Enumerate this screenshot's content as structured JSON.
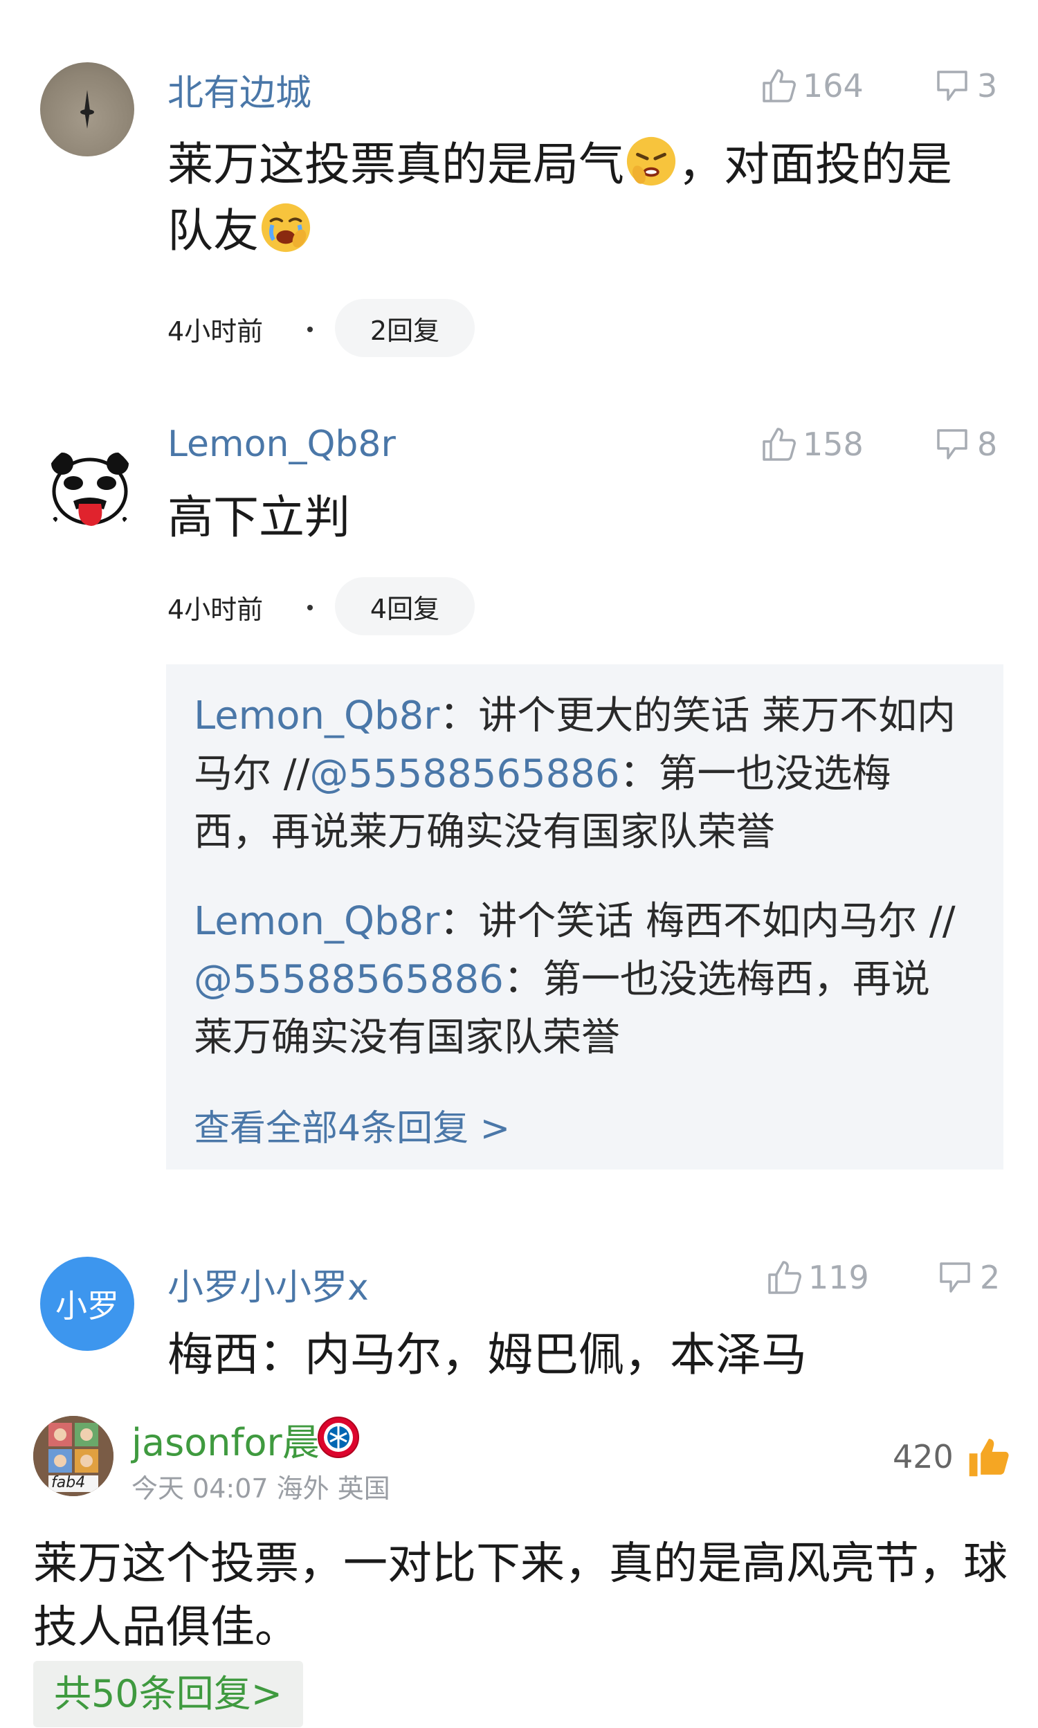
{
  "comments": [
    {
      "username": "北有边城",
      "likes": "164",
      "dislikes": "3",
      "text_line1_a": "莱万这投票真的是局气",
      "text_line1_b": "，对面投的是",
      "text_line2": "队友",
      "emoji1": "angry-face-icon",
      "emoji2": "crying-face-icon",
      "time": "4小时前",
      "replies": "2回复"
    },
    {
      "username": "Lemon_Qb8r",
      "likes": "158",
      "dislikes": "8",
      "text": "高下立判",
      "time": "4小时前",
      "replies": "4回复",
      "sub_replies": [
        {
          "author": "Lemon_Qb8r",
          "sep": "：",
          "line1": "讲个更大的笑话 莱万不如内",
          "line2_a": "马尔 //",
          "mention": "@55588565886",
          "line2_b": "：第一也没选梅",
          "line3": "西，再说莱万确实没有国家队荣誉"
        },
        {
          "author": "Lemon_Qb8r",
          "sep": "：",
          "line1": "讲个笑话 梅西不如内马尔 //",
          "mention": "@55588565886",
          "line2_b": "：第一也没选梅西，再说",
          "line3": "莱万确实没有国家队荣誉"
        }
      ],
      "view_all": "查看全部4条回复 >"
    },
    {
      "username": "小罗小小罗x",
      "avatar_text": "小罗",
      "likes": "119",
      "dislikes": "2",
      "text": "梅西：内马尔，姆巴佩，本泽马"
    }
  ],
  "post": {
    "username": "jasonfor晨",
    "badge": "fc-bayern-badge-icon",
    "meta": "今天 04:07 海外 英国",
    "likes": "420",
    "avatar_text": "fab4",
    "line1": "莱万这个投票，一对比下来，真的是高风亮节，球",
    "line2": "技人品俱佳。",
    "replies_button": "共50条回复>"
  },
  "colors": {
    "link": "#4a77a8",
    "gray": "#a7acb3",
    "green": "#3f9a3f",
    "orange": "#f5a623",
    "avatar_blue": "#3d96ee"
  }
}
